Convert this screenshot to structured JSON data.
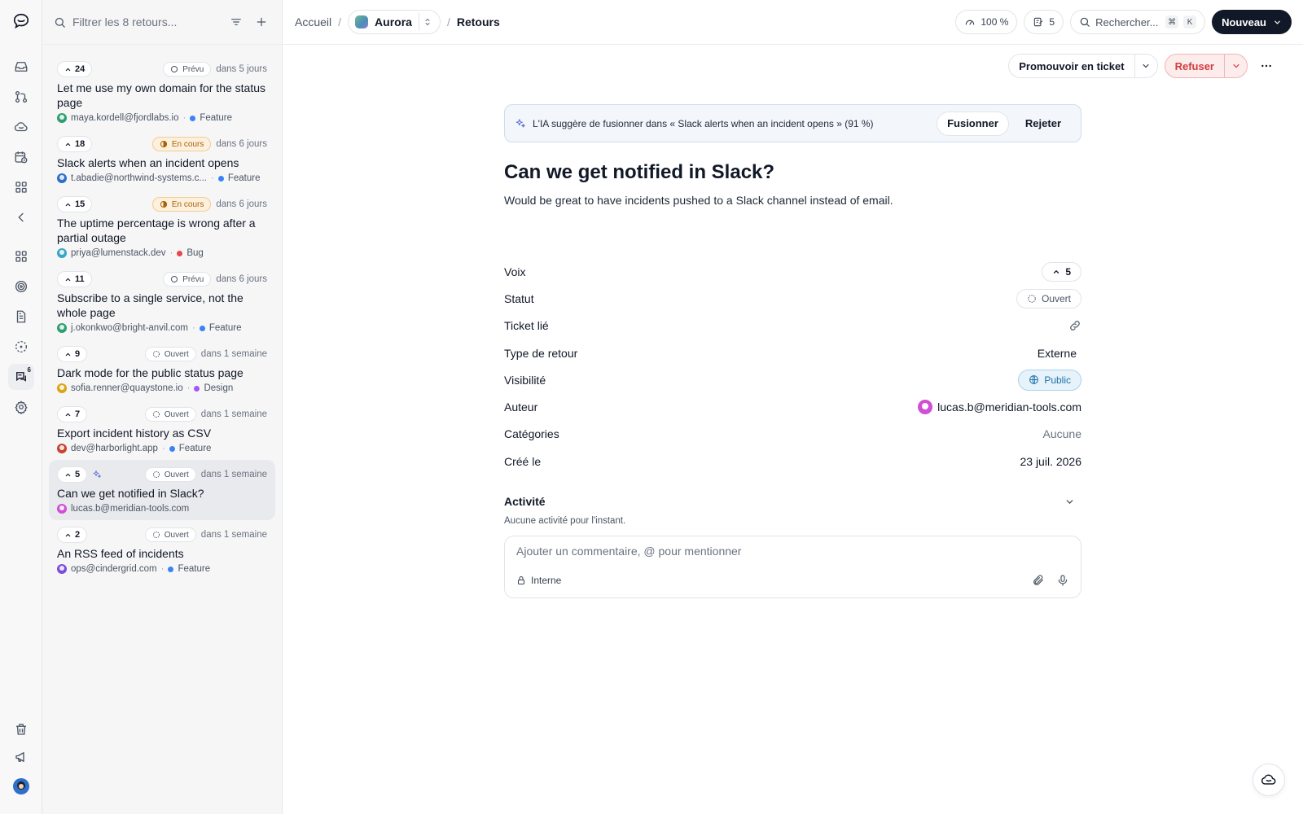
{
  "rail": {
    "items": [
      {
        "name": "inbox-icon"
      },
      {
        "name": "git-pull-request-icon"
      },
      {
        "name": "cloud-icon"
      },
      {
        "name": "calendar-clock-icon"
      },
      {
        "name": "apps-grid-icon"
      },
      {
        "name": "chevron-left-icon"
      },
      {
        "name": "dashboard-grid-icon"
      },
      {
        "name": "target-icon"
      },
      {
        "name": "document-icon"
      },
      {
        "name": "dashed-circle-icon"
      },
      {
        "name": "feedback-icon",
        "badge": "6"
      },
      {
        "name": "settings-icon"
      }
    ],
    "bottom": [
      {
        "name": "trash-icon"
      },
      {
        "name": "megaphone-icon"
      },
      {
        "name": "user-avatar"
      }
    ]
  },
  "list": {
    "filter_placeholder": "Filtrer les 8 retours...",
    "items": [
      {
        "votes": "24",
        "status": "Prévu",
        "status_kind": "prevu",
        "when": "dans 5 jours",
        "title": "Let me use my own domain for the status page",
        "author": "maya.kordell@fjordlabs.io",
        "category": "Feature",
        "category_color": "#3b82f6",
        "avatar_color": "#2f9e72"
      },
      {
        "votes": "18",
        "status": "En cours",
        "status_kind": "encours",
        "when": "dans 6 jours",
        "title": "Slack alerts when an incident opens",
        "author": "t.abadie@northwind-systems.c...",
        "category": "Feature",
        "category_color": "#3b82f6",
        "avatar_color": "#2d6fc9"
      },
      {
        "votes": "15",
        "status": "En cours",
        "status_kind": "encours",
        "when": "dans 6 jours",
        "title": "The uptime percentage is wrong after a partial outage",
        "author": "priya@lumenstack.dev",
        "category": "Bug",
        "category_color": "#e5484d",
        "avatar_color": "#3aa5c9"
      },
      {
        "votes": "11",
        "status": "Prévu",
        "status_kind": "prevu",
        "when": "dans 6 jours",
        "title": "Subscribe to a single service, not the whole page",
        "author": "j.okonkwo@bright-anvil.com",
        "category": "Feature",
        "category_color": "#3b82f6",
        "avatar_color": "#2f9e72"
      },
      {
        "votes": "9",
        "status": "Ouvert",
        "status_kind": "ouvert",
        "when": "dans 1 semaine",
        "title": "Dark mode for the public status page",
        "author": "sofia.renner@quaystone.io",
        "category": "Design",
        "category_color": "#a855f7",
        "avatar_color": "#d9a514"
      },
      {
        "votes": "7",
        "status": "Ouvert",
        "status_kind": "ouvert",
        "when": "dans 1 semaine",
        "title": "Export incident history as CSV",
        "author": "dev@harborlight.app",
        "category": "Feature",
        "category_color": "#3b82f6",
        "avatar_color": "#c9432d"
      },
      {
        "votes": "5",
        "status": "Ouvert",
        "status_kind": "ouvert",
        "when": "dans 1 semaine",
        "title": "Can we get notified in Slack?",
        "author": "lucas.b@meridian-tools.com",
        "category": "",
        "category_color": "",
        "avatar_color": "#d04fd6",
        "ai": true,
        "selected": true
      },
      {
        "votes": "2",
        "status": "Ouvert",
        "status_kind": "ouvert",
        "when": "dans 1 semaine",
        "title": "An RSS feed of incidents",
        "author": "ops@cindergrid.com",
        "category": "Feature",
        "category_color": "#3b82f6",
        "avatar_color": "#7c4ddb"
      }
    ]
  },
  "header": {
    "crumb_home": "Accueil",
    "project": "Aurora",
    "crumb_current": "Retours",
    "zoom": "100 %",
    "notes_count": "5",
    "search_placeholder": "Rechercher...",
    "search_kbd_1": "⌘",
    "search_kbd_2": "K",
    "new_label": "Nouveau"
  },
  "actions": {
    "promote_label": "Promouvoir en ticket",
    "refuse_label": "Refuser"
  },
  "ai_banner": {
    "text": "L'IA suggère de fusionner dans « Slack alerts when an incident opens » (91 %)",
    "merge_label": "Fusionner",
    "reject_label": "Rejeter"
  },
  "detail": {
    "title": "Can we get notified in Slack?",
    "description": "Would be great to have incidents pushed to a Slack channel instead of email."
  },
  "props": {
    "votes_label": "Voix",
    "votes_value": "5",
    "status_label": "Statut",
    "status_value": "Ouvert",
    "ticket_label": "Ticket lié",
    "type_label": "Type de retour",
    "type_value": "Externe",
    "visibility_label": "Visibilité",
    "visibility_value": "Public",
    "author_label": "Auteur",
    "author_value": "lucas.b@meridian-tools.com",
    "categories_label": "Catégories",
    "categories_value": "Aucune",
    "created_label": "Créé le",
    "created_value": "23 juil. 2026"
  },
  "activity": {
    "title": "Activité",
    "empty": "Aucune activité pour l'instant.",
    "comment_placeholder": "Ajouter un commentaire, @ pour mentionner",
    "internal_label": "Interne"
  }
}
